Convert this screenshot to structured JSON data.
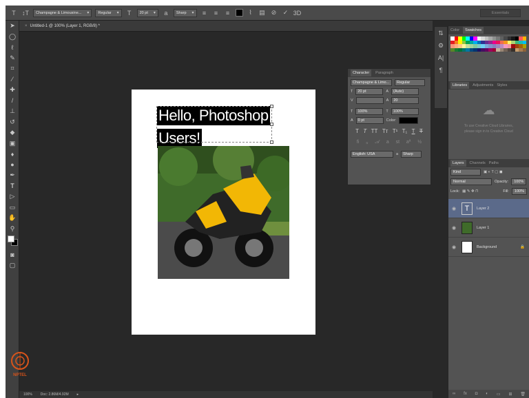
{
  "optbar": {
    "font_family": "Champagne & Limousine...",
    "font_style": "Regular",
    "font_size": "20 pt",
    "aa_label": "a",
    "antialias": "Sharp",
    "workspace": "Essentials"
  },
  "document_tab": {
    "title": "Untitled-1 @ 100% (Layer 1, RGB/8) *"
  },
  "canvas": {
    "text_line1": "Hello, Photoshop",
    "text_line2": "Users!"
  },
  "statusbar": {
    "zoom": "100%",
    "doc_size": "Doc: 2.86M/4.92M"
  },
  "logo": {
    "text": "NPTEL"
  },
  "character_panel": {
    "tabs": [
      "Character",
      "Paragraph"
    ],
    "font_family": "Champagne & Limo...",
    "font_style": "Regular",
    "size": "20 pt",
    "leading": "(Auto)",
    "tracking": "20",
    "v_scale": "100%",
    "h_scale": "100%",
    "baseline": "0 pt",
    "color_label": "Color:",
    "language": "English: USA",
    "aa_label": "a",
    "antialias": "Sharp"
  },
  "swatches_panel": {
    "tabs": [
      "Color",
      "Swatches"
    ],
    "colors": [
      "#ffffff",
      "#ff0000",
      "#ffff00",
      "#00ff00",
      "#00ffff",
      "#0000ff",
      "#ff00ff",
      "#f0f0f0",
      "#d8d8d8",
      "#c0c0c0",
      "#a8a8a8",
      "#909090",
      "#787878",
      "#606060",
      "#484848",
      "#303030",
      "#181818",
      "#000000",
      "#ff5a5a",
      "#ffb400",
      "#e31b23",
      "#f47b20",
      "#fff200",
      "#8dc63f",
      "#00a651",
      "#00a99d",
      "#00aeef",
      "#0072bc",
      "#2e3192",
      "#662d91",
      "#92278f",
      "#ec008c",
      "#ed145b",
      "#f26c4f",
      "#f7941d",
      "#fff568",
      "#acd373",
      "#3cb878",
      "#1cbbb4",
      "#00bff3",
      "#f69679",
      "#fbad82",
      "#fdc68a",
      "#fff799",
      "#c4df9b",
      "#a3d39c",
      "#82ca9c",
      "#7accc8",
      "#6dcff6",
      "#7da7d9",
      "#8393ca",
      "#8781bd",
      "#a186be",
      "#bd8cbf",
      "#f49ac1",
      "#f5989d",
      "#9e0b0f",
      "#a0410d",
      "#a36209",
      "#aba000",
      "#598527",
      "#197b30",
      "#007236",
      "#00746b",
      "#0076a3",
      "#004a80",
      "#003471",
      "#1b1464",
      "#440e62",
      "#630460",
      "#9e005d",
      "#9e0039",
      "#c7b299",
      "#998675",
      "#736357",
      "#534741",
      "#37302a",
      "#c69c6d",
      "#a67c52",
      "#8c6239"
    ]
  },
  "libraries_panel": {
    "tabs": [
      "Libraries",
      "Adjustments",
      "Styles"
    ],
    "message_line1": "To use Creative Cloud Libraries,",
    "message_line2": "please sign in to Creative Cloud"
  },
  "layers_panel": {
    "tabs": [
      "Layers",
      "Channels",
      "Paths"
    ],
    "kind": "Kind",
    "blend": "Normal",
    "opacity_label": "Opacity:",
    "opacity": "100%",
    "lock_label": "Lock:",
    "fill_label": "Fill:",
    "fill": "100%",
    "layers": [
      {
        "name": "Layer 2",
        "type": "text",
        "selected": true
      },
      {
        "name": "Layer 1",
        "type": "image",
        "selected": false
      },
      {
        "name": "Background",
        "type": "fill",
        "selected": false
      }
    ]
  }
}
